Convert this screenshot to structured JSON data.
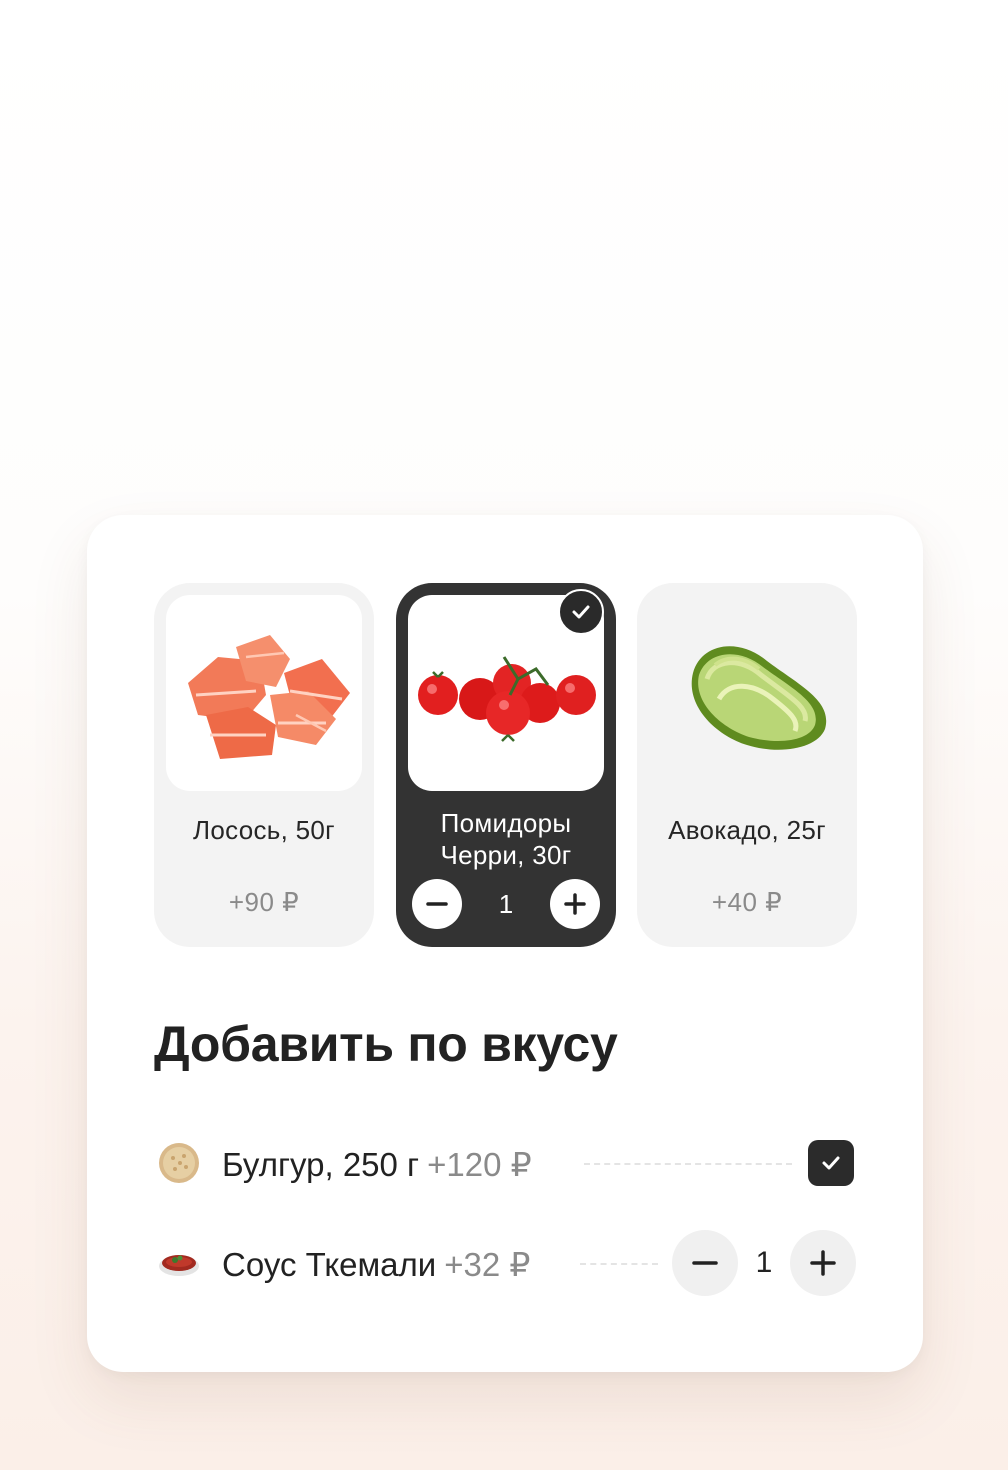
{
  "toppings": [
    {
      "name": "Лосось, 50г",
      "price": "+90 ₽",
      "selected": false,
      "image": "salmon-image"
    },
    {
      "name_line1": "Помидоры",
      "name_line2": "Черри, 30г",
      "quantity": "1",
      "selected": true,
      "image": "cherry-tomatoes-image"
    },
    {
      "name": "Авокадо, 25г",
      "price": "+40 ₽",
      "selected": false,
      "image": "avocado-image"
    }
  ],
  "section": {
    "title": "Добавить по вкусу"
  },
  "extras": [
    {
      "name": "Булгур, 250 г",
      "price": "+120 ₽",
      "checked": true,
      "icon": "bulgur-icon"
    },
    {
      "name": "Соус Ткемали",
      "price": "+32 ₽",
      "quantity": "1",
      "icon": "tkemali-sauce-icon"
    }
  ],
  "colors": {
    "accent_dark": "#333333",
    "muted_text": "#8a8a8a",
    "tile_bg": "#f3f3f3"
  }
}
